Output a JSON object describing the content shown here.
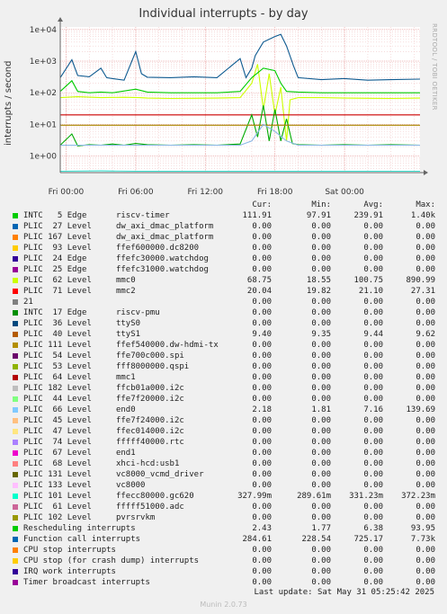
{
  "chart_data": {
    "type": "line",
    "title": "Individual interrupts - by day",
    "side_label": "RRDTOOL / TOBI OETIKER",
    "ylabel": "interrupts / second",
    "yscale": "log",
    "ylim": [
      0.3,
      12000
    ],
    "yticks": [
      {
        "v": 10000,
        "label": "1e+04"
      },
      {
        "v": 1000,
        "label": "1e+03"
      },
      {
        "v": 100,
        "label": "1e+02"
      },
      {
        "v": 10,
        "label": "1e+01"
      },
      {
        "v": 1,
        "label": "1e+00"
      }
    ],
    "xlim": [
      -0.5,
      30.5
    ],
    "xticks": [
      {
        "v": 0,
        "label": "Fri 00:00"
      },
      {
        "v": 6,
        "label": "Fri 06:00"
      },
      {
        "v": 12,
        "label": "Fri 12:00"
      },
      {
        "v": 18,
        "label": "Fri 18:00"
      },
      {
        "v": 24,
        "label": "Sat 00:00"
      }
    ],
    "grid": true,
    "plotted_series": [
      {
        "label": "Function call interrupts",
        "color": "#0f5a90",
        "points": [
          [
            -0.5,
            300
          ],
          [
            0.5,
            1100
          ],
          [
            1,
            350
          ],
          [
            2,
            320
          ],
          [
            3,
            600
          ],
          [
            3.5,
            300
          ],
          [
            4,
            280
          ],
          [
            5,
            250
          ],
          [
            6,
            2000
          ],
          [
            6.5,
            400
          ],
          [
            7,
            310
          ],
          [
            9,
            300
          ],
          [
            11,
            320
          ],
          [
            13,
            300
          ],
          [
            15,
            1200
          ],
          [
            15.5,
            300
          ],
          [
            16,
            600
          ],
          [
            16.3,
            1500
          ],
          [
            17,
            4000
          ],
          [
            18,
            6000
          ],
          [
            18.5,
            7000
          ],
          [
            19,
            3000
          ],
          [
            19.6,
            700
          ],
          [
            20,
            300
          ],
          [
            22,
            260
          ],
          [
            24,
            280
          ],
          [
            26,
            250
          ],
          [
            28,
            260
          ],
          [
            30.5,
            270
          ]
        ]
      },
      {
        "label": "PLIC 62 Level mmc0",
        "color": "#ccff00",
        "points": [
          [
            -0.5,
            70
          ],
          [
            1,
            75
          ],
          [
            3,
            70
          ],
          [
            5,
            72
          ],
          [
            6.3,
            70
          ],
          [
            7,
            68
          ],
          [
            9,
            66
          ],
          [
            11,
            67
          ],
          [
            13,
            68
          ],
          [
            15,
            70
          ],
          [
            16,
            200
          ],
          [
            16.5,
            800
          ],
          [
            17,
            30
          ],
          [
            17.5,
            400
          ],
          [
            18,
            20
          ],
          [
            18.5,
            150
          ],
          [
            19,
            3
          ],
          [
            19.3,
            60
          ],
          [
            20,
            70
          ],
          [
            22,
            70
          ],
          [
            24,
            68
          ],
          [
            26,
            67
          ],
          [
            28,
            66
          ],
          [
            30.5,
            68
          ]
        ]
      },
      {
        "label": "INTC 5 Edge riscv-timer",
        "color": "#00cc00",
        "points": [
          [
            -0.5,
            110
          ],
          [
            0.5,
            240
          ],
          [
            1,
            110
          ],
          [
            2,
            100
          ],
          [
            3,
            105
          ],
          [
            4,
            100
          ],
          [
            6,
            130
          ],
          [
            7,
            105
          ],
          [
            9,
            100
          ],
          [
            11,
            100
          ],
          [
            13,
            100
          ],
          [
            15,
            110
          ],
          [
            16,
            300
          ],
          [
            17,
            600
          ],
          [
            18,
            500
          ],
          [
            18.5,
            200
          ],
          [
            19,
            110
          ],
          [
            20,
            105
          ],
          [
            22,
            100
          ],
          [
            24,
            100
          ],
          [
            26,
            100
          ],
          [
            28,
            100
          ],
          [
            30.5,
            100
          ]
        ]
      },
      {
        "label": "PLIC 71 Level mmc2",
        "color": "#cc0000",
        "points": [
          [
            -0.5,
            20
          ],
          [
            3,
            20
          ],
          [
            6,
            20
          ],
          [
            9,
            20
          ],
          [
            12,
            20
          ],
          [
            15,
            20
          ],
          [
            18,
            20
          ],
          [
            21,
            20
          ],
          [
            24,
            20
          ],
          [
            27,
            20
          ],
          [
            30.5,
            20
          ]
        ]
      },
      {
        "label": "Rescheduling interrupts",
        "color": "#00aa00",
        "points": [
          [
            -0.5,
            2.2
          ],
          [
            0.5,
            5
          ],
          [
            1,
            2.1
          ],
          [
            2,
            2.3
          ],
          [
            3,
            2.2
          ],
          [
            4,
            2.4
          ],
          [
            5,
            2.2
          ],
          [
            6,
            2.5
          ],
          [
            7,
            2.3
          ],
          [
            9,
            2.2
          ],
          [
            11,
            2.3
          ],
          [
            13,
            2.2
          ],
          [
            15,
            2.4
          ],
          [
            16,
            20
          ],
          [
            16.5,
            4
          ],
          [
            17,
            40
          ],
          [
            17.5,
            3
          ],
          [
            18,
            30
          ],
          [
            18.5,
            3
          ],
          [
            19,
            15
          ],
          [
            19.5,
            2.5
          ],
          [
            20,
            2.3
          ],
          [
            22,
            2.2
          ],
          [
            24,
            2.3
          ],
          [
            26,
            2.2
          ],
          [
            28,
            2.3
          ],
          [
            30.5,
            2.2
          ]
        ]
      },
      {
        "label": "PLIC 40 Level ttyS1",
        "color": "#aa8800",
        "points": [
          [
            -0.5,
            9.4
          ],
          [
            6,
            9.4
          ],
          [
            12,
            9.4
          ],
          [
            18,
            9.4
          ],
          [
            24,
            9.4
          ],
          [
            30.5,
            9.4
          ]
        ]
      },
      {
        "label": "PLIC 66 Level end0",
        "color": "#8ab8e6",
        "points": [
          [
            -0.5,
            2.2
          ],
          [
            3,
            2.2
          ],
          [
            6,
            2.2
          ],
          [
            9,
            2.2
          ],
          [
            12,
            2.2
          ],
          [
            15,
            2.2
          ],
          [
            16,
            3
          ],
          [
            17,
            10
          ],
          [
            18,
            6
          ],
          [
            19,
            3
          ],
          [
            20,
            2.2
          ],
          [
            24,
            2.2
          ],
          [
            30.5,
            2.2
          ]
        ]
      },
      {
        "label": "PLIC 101 Level ffecc80000.gc620",
        "color": "#33ddcc",
        "points": [
          [
            -0.5,
            0.33
          ],
          [
            3,
            0.34
          ],
          [
            6,
            0.33
          ],
          [
            9,
            0.33
          ],
          [
            12,
            0.33
          ],
          [
            15,
            0.33
          ],
          [
            18,
            0.33
          ],
          [
            21,
            0.33
          ],
          [
            24,
            0.33
          ],
          [
            27,
            0.33
          ],
          [
            30.5,
            0.33
          ]
        ]
      }
    ],
    "columns": [
      "Cur:",
      "Min:",
      "Avg:",
      "Max:"
    ],
    "legend": [
      {
        "label": "INTC   5 Edge      riscv-timer",
        "color": "#00cc00",
        "cur": "111.91",
        "min": "97.91",
        "avg": "239.91",
        "max": "1.40k"
      },
      {
        "label": "PLIC  27 Level     dw_axi_dmac_platform",
        "color": "#0066b3",
        "cur": "0.00",
        "min": "0.00",
        "avg": "0.00",
        "max": "0.00"
      },
      {
        "label": "PLIC 167 Level     dw_axi_dmac_platform",
        "color": "#ff8000",
        "cur": "0.00",
        "min": "0.00",
        "avg": "0.00",
        "max": "0.00"
      },
      {
        "label": "PLIC  93 Level     ffef600000.dc8200",
        "color": "#ffcc00",
        "cur": "0.00",
        "min": "0.00",
        "avg": "0.00",
        "max": "0.00"
      },
      {
        "label": "PLIC  24 Edge      ffefc30000.watchdog",
        "color": "#330099",
        "cur": "0.00",
        "min": "0.00",
        "avg": "0.00",
        "max": "0.00"
      },
      {
        "label": "PLIC  25 Edge      ffefc31000.watchdog",
        "color": "#990099",
        "cur": "0.00",
        "min": "0.00",
        "avg": "0.00",
        "max": "0.00"
      },
      {
        "label": "PLIC  62 Level     mmc0",
        "color": "#ccff00",
        "cur": "68.75",
        "min": "18.55",
        "avg": "100.75",
        "max": "890.99"
      },
      {
        "label": "PLIC  71 Level     mmc2",
        "color": "#ff0000",
        "cur": "20.04",
        "min": "19.82",
        "avg": "21.10",
        "max": "27.31"
      },
      {
        "label": "21",
        "color": "#808080",
        "cur": "0.00",
        "min": "0.00",
        "avg": "0.00",
        "max": "0.00"
      },
      {
        "label": "INTC  17 Edge      riscv-pmu",
        "color": "#008f00",
        "cur": "0.00",
        "min": "0.00",
        "avg": "0.00",
        "max": "0.00"
      },
      {
        "label": "PLIC  36 Level     ttyS0",
        "color": "#00487d",
        "cur": "0.00",
        "min": "0.00",
        "avg": "0.00",
        "max": "0.00"
      },
      {
        "label": "PLIC  40 Level     ttyS1",
        "color": "#b35a00",
        "cur": "9.40",
        "min": "9.35",
        "avg": "9.44",
        "max": "9.62"
      },
      {
        "label": "PLIC 111 Level     ffef540000.dw-hdmi-tx",
        "color": "#b38f00",
        "cur": "0.00",
        "min": "0.00",
        "avg": "0.00",
        "max": "0.00"
      },
      {
        "label": "PLIC  54 Level     ffe700c000.spi",
        "color": "#6b006b",
        "cur": "0.00",
        "min": "0.00",
        "avg": "0.00",
        "max": "0.00"
      },
      {
        "label": "PLIC  53 Level     fff8000000.qspi",
        "color": "#8fb300",
        "cur": "0.00",
        "min": "0.00",
        "avg": "0.00",
        "max": "0.00"
      },
      {
        "label": "PLIC  64 Level     mmc1",
        "color": "#b30000",
        "cur": "0.00",
        "min": "0.00",
        "avg": "0.00",
        "max": "0.00"
      },
      {
        "label": "PLIC 182 Level     ffcb01a000.i2c",
        "color": "#bebebe",
        "cur": "0.00",
        "min": "0.00",
        "avg": "0.00",
        "max": "0.00"
      },
      {
        "label": "PLIC  44 Level     ffe7f20000.i2c",
        "color": "#80ff80",
        "cur": "0.00",
        "min": "0.00",
        "avg": "0.00",
        "max": "0.00"
      },
      {
        "label": "PLIC  66 Level     end0",
        "color": "#80c9ff",
        "cur": "2.18",
        "min": "1.81",
        "avg": "7.16",
        "max": "139.69"
      },
      {
        "label": "PLIC  45 Level     ffe7f24000.i2c",
        "color": "#ffc080",
        "cur": "0.00",
        "min": "0.00",
        "avg": "0.00",
        "max": "0.00"
      },
      {
        "label": "PLIC  47 Level     ffec014000.i2c",
        "color": "#ffe680",
        "cur": "0.00",
        "min": "0.00",
        "avg": "0.00",
        "max": "0.00"
      },
      {
        "label": "PLIC  74 Level     fffff40000.rtc",
        "color": "#aa80ff",
        "cur": "0.00",
        "min": "0.00",
        "avg": "0.00",
        "max": "0.00"
      },
      {
        "label": "PLIC  67 Level     end1",
        "color": "#ee00cc",
        "cur": "0.00",
        "min": "0.00",
        "avg": "0.00",
        "max": "0.00"
      },
      {
        "label": "PLIC  68 Level     xhci-hcd:usb1",
        "color": "#ff8080",
        "cur": "0.00",
        "min": "0.00",
        "avg": "0.00",
        "max": "0.00"
      },
      {
        "label": "PLIC 131 Level     vc8000_vcmd_driver",
        "color": "#666600",
        "cur": "0.00",
        "min": "0.00",
        "avg": "0.00",
        "max": "0.00"
      },
      {
        "label": "PLIC 133 Level     vc8000",
        "color": "#ffbfff",
        "cur": "0.00",
        "min": "0.00",
        "avg": "0.00",
        "max": "0.00"
      },
      {
        "label": "PLIC 101 Level     ffecc80000.gc620",
        "color": "#00ffcc",
        "cur": "327.99m",
        "min": "289.61m",
        "avg": "331.23m",
        "max": "372.23m"
      },
      {
        "label": "PLIC  61 Level     fffff51000.adc",
        "color": "#cc6699",
        "cur": "0.00",
        "min": "0.00",
        "avg": "0.00",
        "max": "0.00"
      },
      {
        "label": "PLIC 102 Level     pvrsrvkm",
        "color": "#999900",
        "cur": "0.00",
        "min": "0.00",
        "avg": "0.00",
        "max": "0.00"
      },
      {
        "label": "Rescheduling interrupts",
        "color": "#00cc00",
        "cur": "2.43",
        "min": "1.77",
        "avg": "6.38",
        "max": "93.95"
      },
      {
        "label": "Function call interrupts",
        "color": "#0066b3",
        "cur": "284.61",
        "min": "228.54",
        "avg": "725.17",
        "max": "7.73k"
      },
      {
        "label": "CPU stop interrupts",
        "color": "#ff8000",
        "cur": "0.00",
        "min": "0.00",
        "avg": "0.00",
        "max": "0.00"
      },
      {
        "label": "CPU stop (for crash dump) interrupts",
        "color": "#ffcc00",
        "cur": "0.00",
        "min": "0.00",
        "avg": "0.00",
        "max": "0.00"
      },
      {
        "label": "IRQ work interrupts",
        "color": "#330099",
        "cur": "0.00",
        "min": "0.00",
        "avg": "0.00",
        "max": "0.00"
      },
      {
        "label": "Timer broadcast interrupts",
        "color": "#990099",
        "cur": "0.00",
        "min": "0.00",
        "avg": "0.00",
        "max": "0.00"
      }
    ]
  },
  "footer": {
    "last_update": "Last update: Sat May 31 05:25:42 2025",
    "munin_version": "Munin 2.0.73"
  }
}
